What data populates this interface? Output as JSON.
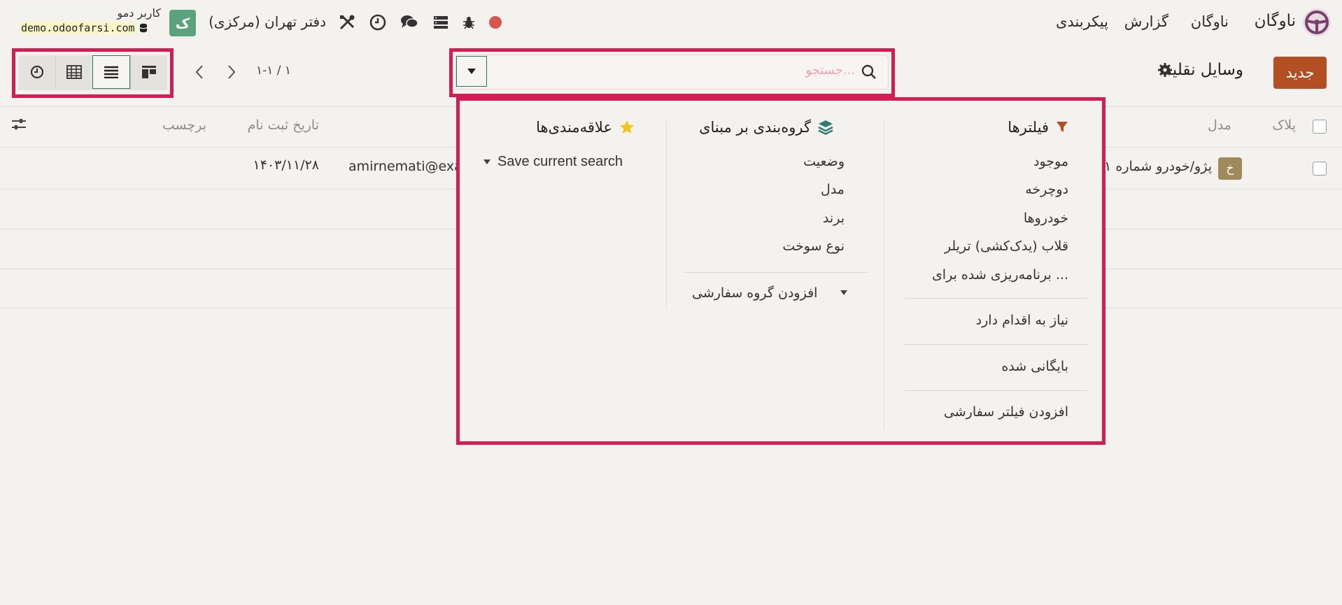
{
  "navbar": {
    "app_name": "ناوگان",
    "menu": [
      "ناوگان",
      "گزارش",
      "پیکربندی"
    ],
    "company": "دفتر تهران (مرکزی)",
    "user_initial": "ک",
    "user_name": "کاربر دمو",
    "database": "demo.odoofarsi.com"
  },
  "control": {
    "new_button": "جدید",
    "title": "وسایل نقلیه",
    "search_placeholder": "جستجو...",
    "pager": "۱-۱ / ۱"
  },
  "list": {
    "columns": [
      "پلاک",
      "مدل",
      "تاریخ ثبت نام",
      "برچسب"
    ],
    "rows": [
      {
        "badge": "خ",
        "model": "پژو/خودرو شماره ۱",
        "email": "amirnemati@exa",
        "date": "۱۴۰۳/۱۱/۲۸"
      }
    ]
  },
  "dropdown": {
    "filters": {
      "title": "فیلترها",
      "items": [
        "موجود",
        "دوچرخه",
        "خودروها",
        "قلاب (یدک‌کشی) تریلر",
        "برنامه‌ریزی شده برای ..."
      ],
      "needs_action": "نیاز به اقدام دارد",
      "archived": "بایگانی شده",
      "add_custom": "افزودن فیلتر سفارشی"
    },
    "groupby": {
      "title": "گروه‌بندی بر مبنای",
      "items": [
        "وضعیت",
        "مدل",
        "برند",
        "نوع سوخت"
      ],
      "add_custom": "افزودن گروه سفارشی"
    },
    "favorites": {
      "title": "علاقه‌مندی‌ها",
      "save_search": "Save current search"
    }
  },
  "colors": {
    "accent": "#b44f24",
    "highlight": "#d41d55",
    "teal": "#2f6f6a",
    "badge": "#a0895b",
    "avatar": "#5aa37d",
    "record_dot": "#d9534f"
  }
}
